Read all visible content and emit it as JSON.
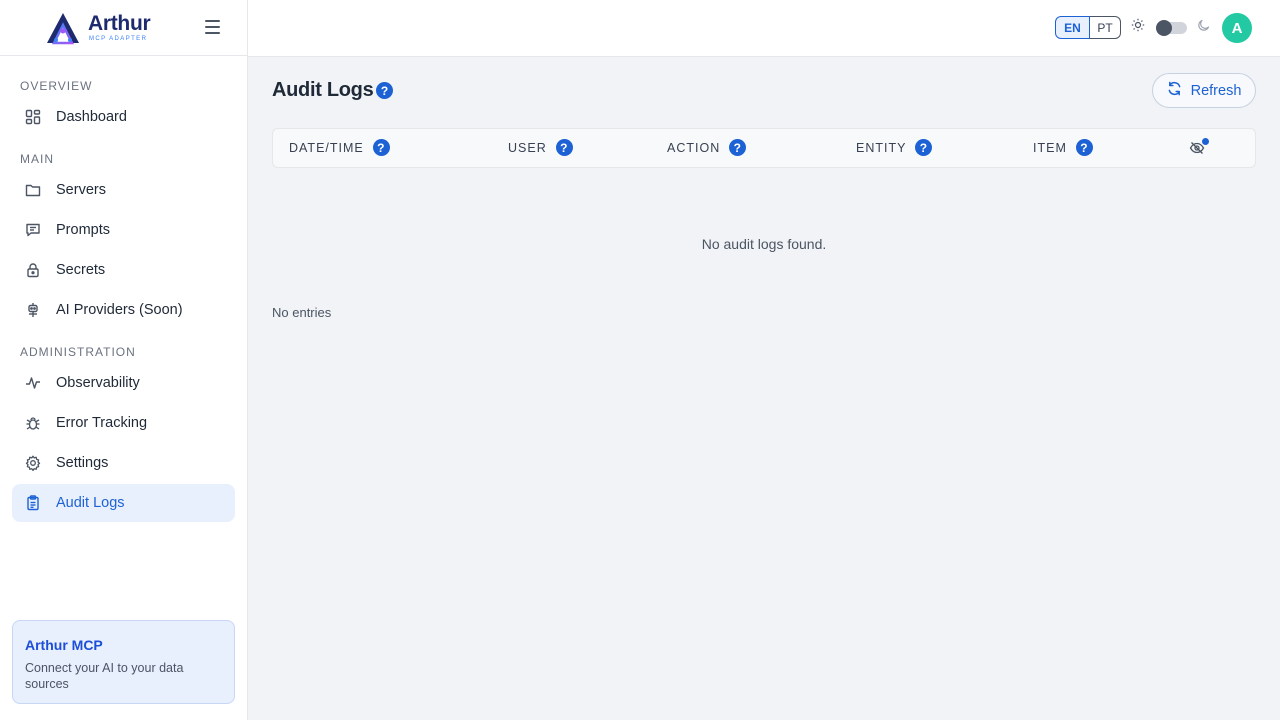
{
  "brand": {
    "name": "Arthur",
    "subtitle": "MCP ADAPTER"
  },
  "sidebar": {
    "sections": {
      "overview": "OVERVIEW",
      "main": "MAIN",
      "administration": "ADMINISTRATION"
    },
    "items": {
      "dashboard": "Dashboard",
      "servers": "Servers",
      "prompts": "Prompts",
      "secrets": "Secrets",
      "ai_providers": "AI Providers (Soon)",
      "observability": "Observability",
      "error_tracking": "Error Tracking",
      "settings": "Settings",
      "audit_logs": "Audit Logs"
    },
    "active": "audit_logs"
  },
  "promo": {
    "title": "Arthur MCP",
    "text": "Connect your AI to your data sources"
  },
  "header": {
    "lang_en": "EN",
    "lang_pt": "PT",
    "avatar_initial": "A"
  },
  "colors": {
    "accent": "#1d62d4",
    "avatar": "#22c9a3",
    "active_bg": "#e8f0fe"
  },
  "main": {
    "title": "Audit Logs",
    "refresh_label": "Refresh",
    "columns": {
      "datetime": "DATE/TIME",
      "user": "USER",
      "action": "ACTION",
      "entity": "ENTITY",
      "item": "ITEM"
    },
    "empty_message": "No audit logs found.",
    "entries_text": "No entries"
  }
}
